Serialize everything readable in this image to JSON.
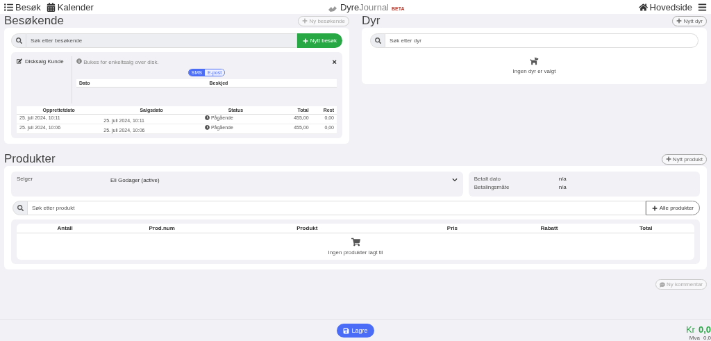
{
  "nav": {
    "links": [
      {
        "label": "Besøk"
      },
      {
        "label": "Kalender"
      }
    ],
    "brand": {
      "name_a": "Dyre",
      "name_b": "Journal",
      "badge": "BETA"
    },
    "home": "Hovedside"
  },
  "visitors": {
    "title": "Besøkende",
    "add_button": "Ny besøkende",
    "search": {
      "placeholder": "Søk etter besøkende"
    },
    "new_visit_button": "Nytt besøk",
    "customer": {
      "name": "Disksalg Kunde",
      "note": "Bukes for enkeltsalg over disk.",
      "close": "×",
      "message_tabs": [
        {
          "label": "SMS",
          "selected": true
        },
        {
          "label": "E-post",
          "selected": false
        }
      ],
      "message_columns": [
        "Dato",
        "Beskjed"
      ],
      "sales_columns": [
        "Opprettetdato",
        "Salgsdato",
        "Status",
        "Total",
        "Rest"
      ],
      "sales": [
        {
          "created": "25. juli 2024, 10:11",
          "sold": "25. juli 2024, 10:11",
          "status": "Pågående",
          "total": "455,00",
          "rest": "0,00"
        },
        {
          "created": "25. juli 2024, 10:06",
          "sold": "25. juli 2024, 10:06",
          "status": "Pågående",
          "total": "455,00",
          "rest": "0,00"
        }
      ]
    }
  },
  "animals": {
    "title": "Dyr",
    "add_button": "Nytt dyr",
    "search": {
      "placeholder": "Søk etter dyr"
    },
    "empty": "Ingen dyr er valgt"
  },
  "products": {
    "title": "Produkter",
    "add_button": "Nytt produkt",
    "seller_label": "Selger",
    "seller_value": "Eli Godager (active)",
    "payment": [
      {
        "label": "Betalt dato",
        "value": "n/a"
      },
      {
        "label": "Betalingsmåte",
        "value": "n/a"
      }
    ],
    "search": {
      "placeholder": "Søk etter produkt"
    },
    "all_button": "Alle produkter",
    "columns": [
      "Antall",
      "Prod.num",
      "Produkt",
      "Pris",
      "Rabatt",
      "Total"
    ],
    "empty": "Ingen produkter lagt til"
  },
  "comment_button": "Ny kommentar",
  "footer": {
    "save_button": "Lagre",
    "currency": "Kr",
    "total": "0,0",
    "vat_label": "Mva",
    "vat": "0,0"
  }
}
